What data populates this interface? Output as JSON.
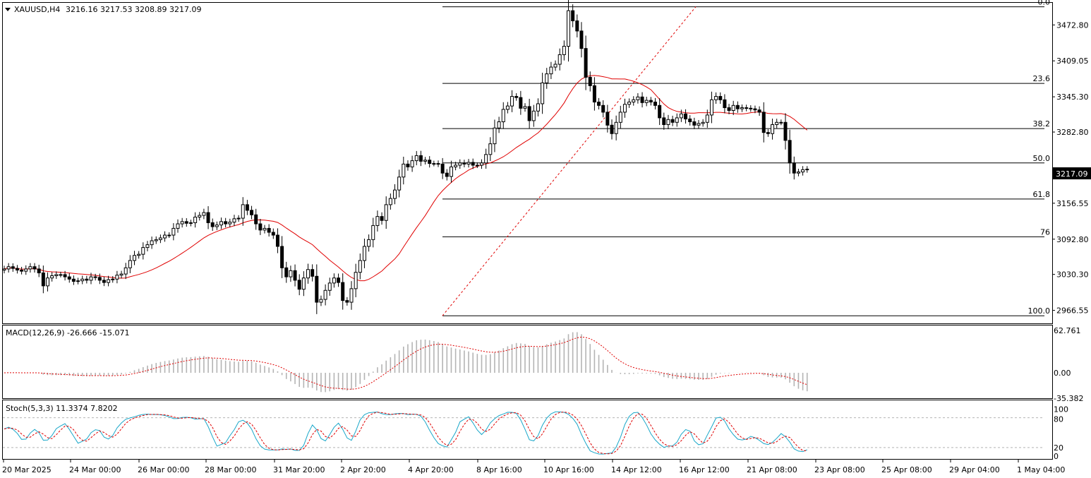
{
  "header": {
    "symbol": "XAUUSD,H4",
    "ohlc": "3216.16 3217.53 3208.89 3217.09"
  },
  "current_price": "3217.09",
  "fibonacci": {
    "levels": [
      {
        "label": "0.0",
        "price": 3505
      },
      {
        "label": "23.6",
        "price": 3369
      },
      {
        "label": "38.2",
        "price": 3289
      },
      {
        "label": "50.0",
        "price": 3228
      },
      {
        "label": "61.8",
        "price": 3164
      },
      {
        "label": "76",
        "price": 3097
      },
      {
        "label": "100.0",
        "price": 2957
      }
    ]
  },
  "indicators": {
    "macd_label": "MACD(12,26,9) -26.666 -15.071",
    "stoch_label": "Stoch(5,3,3) 11.3374 7.8202"
  },
  "colors": {
    "candle_up_fill": "#ffffff",
    "candle_down_fill": "#000000",
    "ma_line": "#e00000",
    "fib_trend": "#e00000",
    "macd_hist": "#b4b4b4",
    "macd_signal": "#e00000",
    "stoch_main": "#19a7c9",
    "stoch_signal": "#e00000"
  },
  "chart_data": [
    {
      "type": "candlestick",
      "title": "XAUUSD,H4",
      "y_ticks": [
        "3472.80",
        "3409.05",
        "3345.30",
        "3282.80",
        "3217.09",
        "3156.55",
        "3092.80",
        "3030.30",
        "2966.55"
      ],
      "x_ticks": [
        "20 Mar 2025",
        "24 Mar 00:00",
        "26 Mar 00:00",
        "28 Mar 00:00",
        "31 Mar 20:00",
        "2 Apr 20:00",
        "4 Apr 20:00",
        "8 Apr 16:00",
        "10 Apr 16:00",
        "14 Apr 12:00",
        "16 Apr 12:00",
        "21 Apr 08:00",
        "23 Apr 08:00",
        "25 Apr 08:00",
        "29 Apr 04:00",
        "1 May 04:00"
      ],
      "ylim": [
        2947,
        3531
      ],
      "close_series": [
        3040,
        3044,
        3041,
        3038,
        3036,
        3040,
        3044,
        3040,
        3033,
        3010,
        3024,
        3028,
        3030,
        3030,
        3026,
        3022,
        3018,
        3019,
        3022,
        3020,
        3026,
        3025,
        3020,
        3016,
        3021,
        3022,
        3029,
        3031,
        3042,
        3055,
        3064,
        3066,
        3078,
        3083,
        3090,
        3092,
        3095,
        3100,
        3100,
        3112,
        3120,
        3124,
        3121,
        3122,
        3132,
        3135,
        3140,
        3122,
        3115,
        3118,
        3124,
        3120,
        3123,
        3129,
        3130,
        3154,
        3144,
        3136,
        3120,
        3109,
        3112,
        3105,
        3100,
        3080,
        3042,
        3026,
        3037,
        3020,
        3004,
        3024,
        3039,
        3027,
        2981,
        2986,
        3002,
        3015,
        3024,
        3016,
        2984,
        2981,
        3005,
        3034,
        3055,
        3080,
        3092,
        3117,
        3133,
        3126,
        3154,
        3165,
        3180,
        3203,
        3226,
        3221,
        3232,
        3241,
        3231,
        3233,
        3227,
        3227,
        3226,
        3210,
        3204,
        3221,
        3224,
        3228,
        3226,
        3229,
        3224,
        3224,
        3228,
        3243,
        3262,
        3290,
        3301,
        3323,
        3329,
        3346,
        3344,
        3325,
        3328,
        3303,
        3320,
        3333,
        3370,
        3386,
        3398,
        3403,
        3420,
        3435,
        3498,
        3480,
        3462,
        3431,
        3380,
        3365,
        3336,
        3330,
        3318,
        3295,
        3280,
        3300,
        3318,
        3332,
        3336,
        3340,
        3345,
        3335,
        3339,
        3336,
        3330,
        3308,
        3296,
        3305,
        3300,
        3308,
        3315,
        3306,
        3301,
        3295,
        3298,
        3300,
        3313,
        3340,
        3346,
        3340,
        3326,
        3321,
        3330,
        3324,
        3326,
        3325,
        3324,
        3322,
        3318,
        3282,
        3280,
        3296,
        3300,
        3300,
        3268,
        3228,
        3210,
        3212,
        3216,
        3217
      ],
      "ma_period": 20,
      "current_price": 3217.09
    },
    {
      "type": "bar",
      "title": "MACD(12,26,9) -26.666 -15.071",
      "y_ticks": [
        "62.761",
        "0.00",
        "-35.382"
      ],
      "ylim": [
        -37,
        65
      ],
      "macd": -26.666,
      "signal": -15.071
    },
    {
      "type": "line",
      "title": "Stoch(5,3,3) 11.3374 7.8202",
      "y_ticks": [
        "100",
        "80",
        "20",
        "0"
      ],
      "ylim": [
        0,
        100
      ],
      "levels": [
        80,
        20
      ],
      "main": 11.3374,
      "signal": 7.8202
    }
  ]
}
